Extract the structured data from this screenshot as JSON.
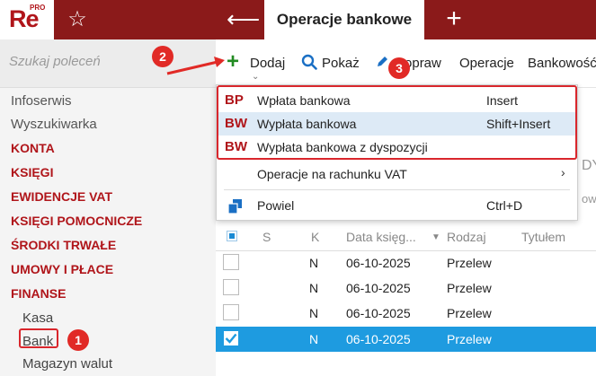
{
  "header": {
    "logo": "Re",
    "logo_pro": "PRO",
    "star_icon": "star-outline-icon",
    "back_icon": "arrow-left-icon",
    "active_tab": "Operacje bankowe",
    "new_tab_icon": "plus-icon"
  },
  "sidebar": {
    "search_placeholder": "Szukaj poleceń",
    "items": [
      {
        "label": "Infoserwis",
        "kind": "plain"
      },
      {
        "label": "Wyszukiwarka",
        "kind": "plain"
      },
      {
        "label": "KONTA",
        "kind": "category"
      },
      {
        "label": "KSIĘGI",
        "kind": "category"
      },
      {
        "label": "EWIDENCJE VAT",
        "kind": "category"
      },
      {
        "label": "KSIĘGI POMOCNICZE",
        "kind": "category"
      },
      {
        "label": "ŚRODKI TRWAŁE",
        "kind": "category"
      },
      {
        "label": "UMOWY I PŁACE",
        "kind": "category"
      },
      {
        "label": "FINANSE",
        "kind": "category"
      },
      {
        "label": "Kasa",
        "kind": "sub"
      },
      {
        "label": "Bank",
        "kind": "sub"
      },
      {
        "label": "Magazyn walut",
        "kind": "sub"
      }
    ]
  },
  "toolbar": {
    "add": "Dodaj",
    "show": "Pokaż",
    "edit": "Popraw",
    "operations": "Operacje",
    "banking": "Bankowość"
  },
  "badges": {
    "b1": "1",
    "b2": "2",
    "b3": "3"
  },
  "menu": {
    "items": [
      {
        "code": "BP",
        "label": "Wpłata bankowa",
        "shortcut": "Insert"
      },
      {
        "code": "BW",
        "label": "Wypłata bankowa",
        "shortcut": "Shift+Insert"
      },
      {
        "code": "BW",
        "label": "Wypłata bankowa z dyspozycji",
        "shortcut": ""
      }
    ],
    "vat": "Operacje na rachunku VAT",
    "duplicate": "Powiel",
    "duplicate_shortcut": "Ctrl+D"
  },
  "background_peek": {
    "right_1": "DY",
    "right_2": "owo"
  },
  "grid": {
    "columns": [
      "S",
      "K",
      "Data księg...",
      "Rodzaj",
      "Tytułem"
    ],
    "rows": [
      {
        "k": "N",
        "date": "06-10-2025",
        "type": "Przelew"
      },
      {
        "k": "N",
        "date": "06-10-2025",
        "type": "Przelew"
      },
      {
        "k": "N",
        "date": "06-10-2025",
        "type": "Przelew"
      },
      {
        "k": "N",
        "date": "06-10-2025",
        "type": "Przelew"
      }
    ]
  },
  "colors": {
    "brand": "#8b1a1a",
    "accent_red": "#b0151a",
    "annotation_red": "#e12a26",
    "selection": "#1e9be0"
  }
}
